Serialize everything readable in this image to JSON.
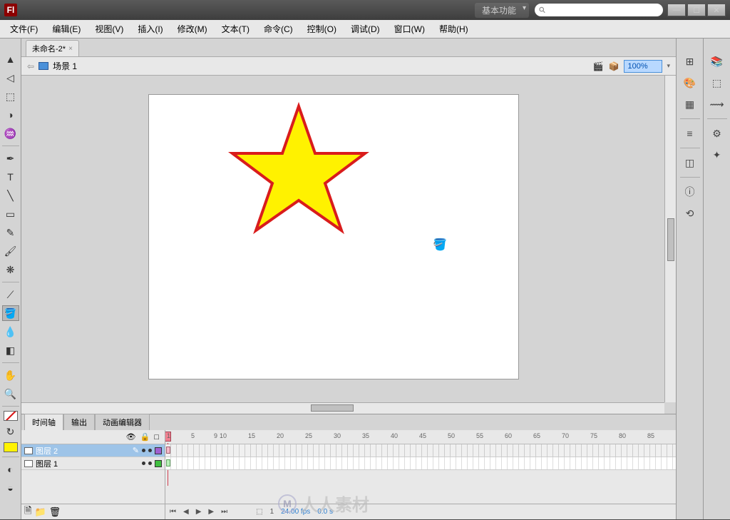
{
  "titlebar": {
    "logo": "Fl",
    "workspace": "基本功能",
    "search_placeholder": ""
  },
  "menubar": {
    "items": [
      "文件(F)",
      "编辑(E)",
      "视图(V)",
      "插入(I)",
      "修改(M)",
      "文本(T)",
      "命令(C)",
      "控制(O)",
      "调试(D)",
      "窗口(W)",
      "帮助(H)"
    ]
  },
  "doc": {
    "tab_name": "未命名-2*",
    "scene": "场景 1",
    "zoom": "100%"
  },
  "timeline": {
    "tabs": [
      "时间轴",
      "输出",
      "动画编辑器"
    ],
    "layer_head_icons": [
      "👁",
      "🔒",
      "□"
    ],
    "layers": [
      {
        "name": "图层 2",
        "selected": true,
        "color": "#a060d0"
      },
      {
        "name": "图层 1",
        "selected": false,
        "color": "#40c040"
      }
    ],
    "ruler_marks": [
      1,
      5,
      10,
      15,
      20,
      25,
      30,
      35,
      40,
      45,
      50,
      55,
      60,
      65,
      70,
      75,
      80,
      85,
      9
    ],
    "status": {
      "frame": "1",
      "fps": "24.00 fps",
      "time": "0.0 s"
    }
  },
  "colors": {
    "stroke": "#d91c1c",
    "fill": "#fff200"
  },
  "watermark": "人人素材"
}
